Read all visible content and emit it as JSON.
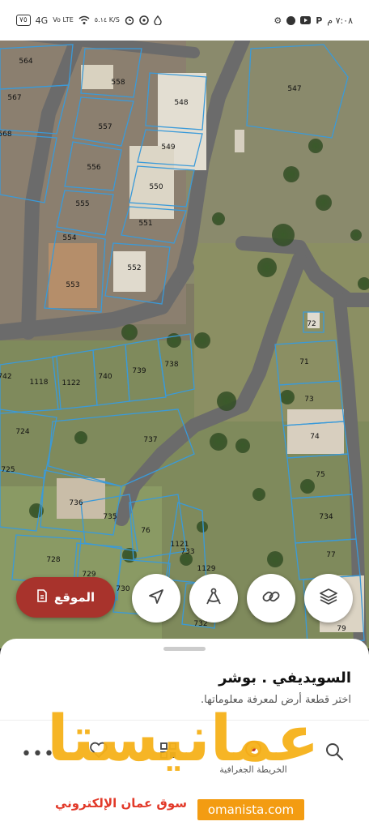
{
  "status_bar": {
    "time": "٧:٠٨ م",
    "battery": "٧٥",
    "network": "4G",
    "volte": "Vo LTE",
    "speed": "٥.١٤ K/S"
  },
  "map": {
    "parcels": [
      "564",
      "558",
      "547",
      "567",
      "548",
      "557",
      "549",
      "568",
      "556",
      "550",
      "555",
      "551",
      "554",
      "552",
      "553",
      "72",
      "742",
      "1118",
      "1122",
      "740",
      "739",
      "738",
      "71",
      "73",
      "724",
      "737",
      "74",
      "725",
      "75",
      "736",
      "735",
      "76",
      "734",
      "1121",
      "733",
      "77",
      "728",
      "729",
      "730",
      "1129",
      "79",
      "732"
    ]
  },
  "controls": {
    "location_label": "الموقع",
    "layers_icon": "layers-icon",
    "link_icon": "link-icon",
    "measure_icon": "compass-measure-icon",
    "navigate_icon": "navigation-arrow-icon"
  },
  "sheet": {
    "title": "السويديفي . بوشر",
    "subtitle": "اختر قطعة أرض لمعرفة معلوماتها.",
    "nav": {
      "map_label": "الخريطة الجغرافية",
      "more_icon": "more-icon",
      "favorite_icon": "heart-icon",
      "grid_icon": "qr-grid-icon",
      "search_icon": "search-icon"
    }
  },
  "watermark": {
    "brand": "عمانيستا",
    "tagline": "سوق عمان الإلكتروني",
    "url": "omanista.com"
  },
  "colors": {
    "location_button": "#a8332c",
    "parcel_line": "#3a9ad9",
    "watermark": "#f6b21a"
  }
}
